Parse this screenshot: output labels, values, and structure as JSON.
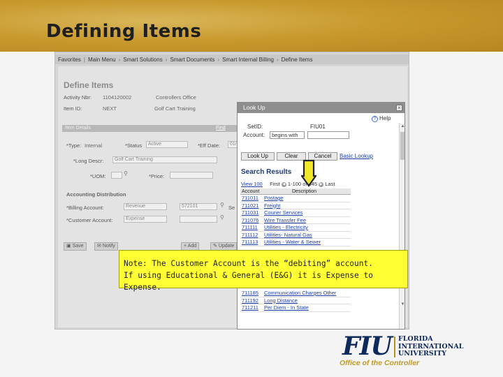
{
  "slide": {
    "title": "Defining Items"
  },
  "nav": {
    "items": [
      "Favorites",
      "Main Menu",
      "Smart Solutions",
      "Smart Documents",
      "Smart Internal Billing",
      "Define Items"
    ]
  },
  "define": {
    "title": "Define Items",
    "activity_label": "Activity Nbr:",
    "activity_value": "1104120002",
    "org_value": "Controllers Office",
    "item_id_label": "Item ID:",
    "item_id_value": "NEXT",
    "item_name_value": "Golf Cart Training",
    "item_details": "Item Details",
    "find_link": "Find",
    "type_label": "*Type:",
    "type_value": "Internal",
    "status_label": "*Status",
    "status_value": "Active",
    "eff_date_label": "*Eff Date:",
    "eff_date_value": "01/",
    "long_desc_label": "*Long Descr:",
    "long_desc_value": "Golf Cart Training",
    "uom_label": "*UOM:",
    "price_label": "*Price:",
    "acct_dist_title": "Accounting Distribution",
    "billing_label": "*Billing Account:",
    "billing_value": "Revenue",
    "billing_acct": "572101",
    "billing_se": "Se",
    "customer_label": "*Customer Account:",
    "customer_value": "Expense",
    "save_label": "Save",
    "notify_label": "Notify",
    "add_label": "Add",
    "update_label": "Update"
  },
  "lookup": {
    "title": "Look Up",
    "help": "Help",
    "setid_label": "SetID:",
    "setid_value": "FIU01",
    "account_label": "Account:",
    "account_op": "begins with",
    "buttons": {
      "lookup": "Look Up",
      "clear": "Clear",
      "cancel": "Cancel",
      "basic": "Basic Lookup"
    },
    "results_title": "Search Results",
    "pager": {
      "view": "View 100",
      "first": "First",
      "range": "1-100 of 345",
      "last": "Last"
    },
    "columns": {
      "account": "Account",
      "description": "Description"
    },
    "rows": [
      {
        "account": "711011",
        "description": "Postage"
      },
      {
        "account": "711021",
        "description": "Freight"
      },
      {
        "account": "711031",
        "description": "Courier Services"
      },
      {
        "account": "711076",
        "description": "Wire Transfer Fee"
      },
      {
        "account": "711111",
        "description": "Utilities - Electricity"
      },
      {
        "account": "711112",
        "description": "Utilities- Natural Gas"
      },
      {
        "account": "711113",
        "description": "Utilities - Water & Sewer"
      }
    ],
    "rows_bottom": [
      {
        "account": "711185",
        "description": "Communication Charges Other"
      },
      {
        "account": "711192",
        "description": "Long Distance"
      },
      {
        "account": "711211",
        "description": "Per Diem - In State"
      }
    ]
  },
  "note": {
    "line1": "Note: The Customer Account is the “debiting” account.",
    "line2": "If using Educational & General (E&G) it is Expense to Expense."
  },
  "logo": {
    "mark": "FIU",
    "name_line1": "FLORIDA",
    "name_line2": "INTERNATIONAL",
    "name_line3": "UNIVERSITY",
    "subtitle": "Office of the Controller"
  },
  "colors": {
    "header_gold": "#c99a2e",
    "note_yellow": "#ffff33",
    "link_blue": "#1f3fa8",
    "fiu_navy": "#0e2a5c",
    "fiu_gold": "#b8901e"
  }
}
